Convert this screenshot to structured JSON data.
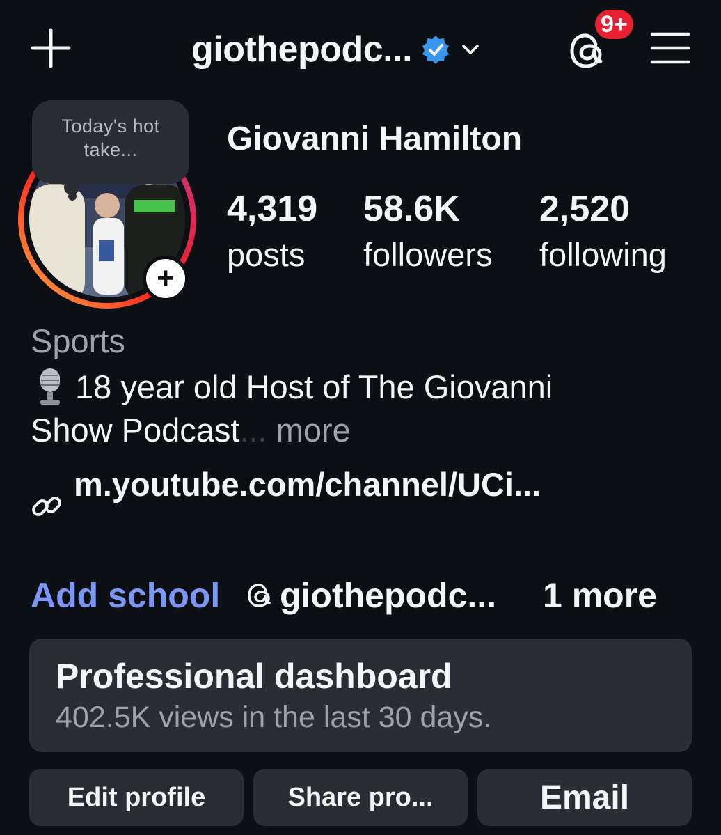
{
  "header": {
    "handle": "giothepodc...",
    "notification_badge": "9+",
    "icons": {
      "create": "plus-icon",
      "verified": "verified-badge-icon",
      "switch_account": "chevron-down-icon",
      "threads": "threads-icon",
      "menu": "hamburger-menu-icon"
    }
  },
  "profile": {
    "note_bubble": "Today's hot take...",
    "full_name": "Giovanni Hamilton",
    "stats": {
      "posts_value": "4,319",
      "posts_label": "posts",
      "followers_value": "58.6K",
      "followers_label": "followers",
      "following_value": "2,520",
      "following_label": "following"
    },
    "add_story_symbol": "+"
  },
  "bio": {
    "category": "Sports",
    "line1": "18 year old Host of The Giovanni",
    "line2": "Show Podcast",
    "ellipsis": "...",
    "more": "more",
    "link": "m.youtube.com/channel/UCi..."
  },
  "links_row": {
    "add_school": "Add school",
    "threads_handle": "giothepodc...",
    "more_links": "1 more"
  },
  "dashboard": {
    "title": "Professional dashboard",
    "subtitle": "402.5K views in the last 30 days."
  },
  "actions": {
    "edit": "Edit profile",
    "share": "Share pro...",
    "email": "Email"
  },
  "colors": {
    "background": "#0c0f14",
    "card": "#2a2d33",
    "accent_link": "#7b96f5",
    "badge_red": "#e8202f",
    "verified_blue": "#3897f0"
  }
}
